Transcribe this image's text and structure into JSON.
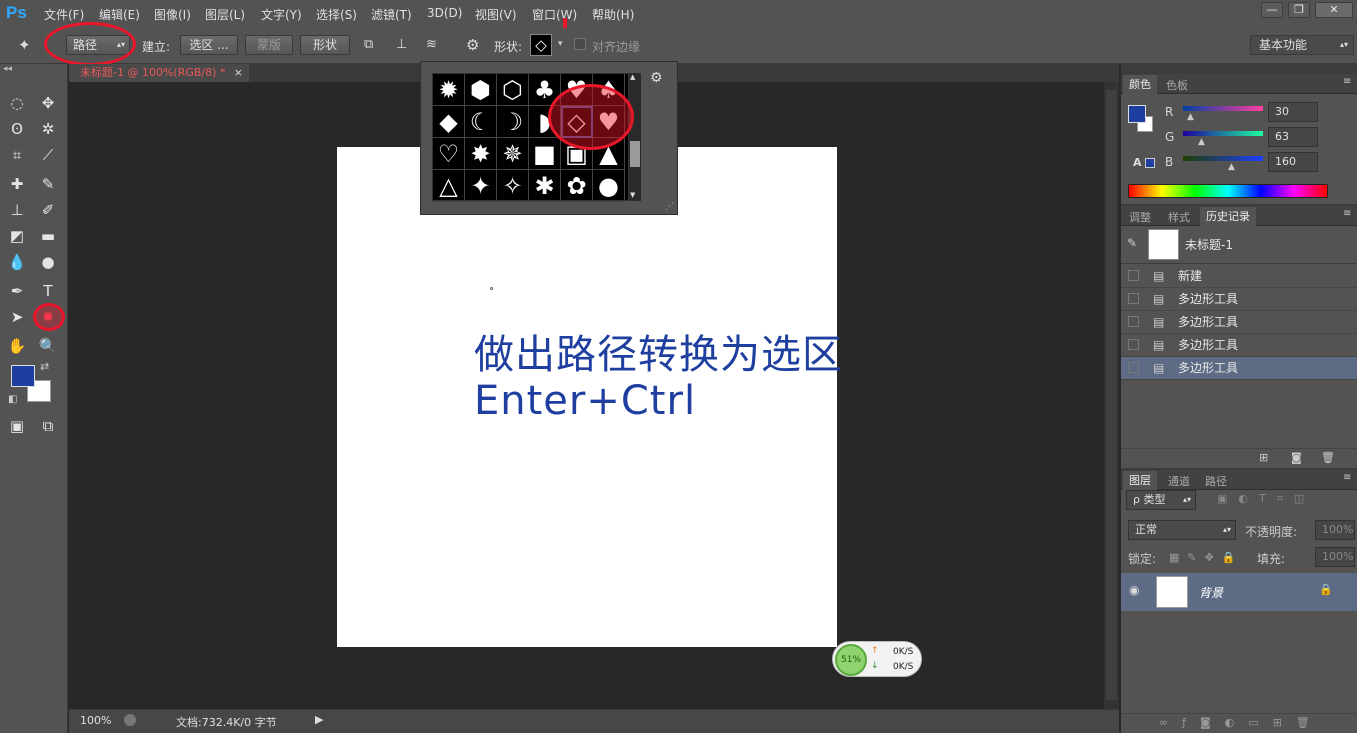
{
  "app": {
    "logo": "Ps"
  },
  "menu": [
    "文件(F)",
    "编辑(E)",
    "图像(I)",
    "图层(L)",
    "文字(Y)",
    "选择(S)",
    "滤镜(T)",
    "3D(D)",
    "视图(V)",
    "窗口(W)",
    "帮助(H)"
  ],
  "window_controls": {
    "minimize": "—",
    "restore": "❐",
    "close": "✕"
  },
  "options": {
    "mode_value": "路径",
    "make_label": "建立:",
    "selection_btn": "选区 ...",
    "mask_btn": "蒙版",
    "shape_btn": "形状",
    "shape_label": "形状:",
    "align_edges": "对齐边缘",
    "workspace": "基本功能"
  },
  "document": {
    "tab_title": "未标题-1 @ 100%(RGB/8) *",
    "tab_close": "×",
    "text_line1": "做出路径转换为选区",
    "text_line2": "Enter+Ctrl"
  },
  "shape_picker": {
    "shapes": [
      "✹",
      "⬢",
      "⬡",
      "♣",
      "♥",
      "♠",
      "◆",
      "☾",
      "☽",
      "◗",
      "◇",
      "♥",
      "♡",
      "✸",
      "✵",
      "■",
      "▣",
      "▲",
      "△",
      "✦",
      "✧",
      "✱",
      "✿",
      "●"
    ]
  },
  "status": {
    "zoom": "100%",
    "doc_info": "文档:732.4K/0 字节"
  },
  "net_widget": {
    "percent": "51%",
    "up": "0K/S",
    "down": "0K/S"
  },
  "color_panel": {
    "tabs": [
      "颜色",
      "色板"
    ],
    "channels": [
      {
        "label": "R",
        "value": "30"
      },
      {
        "label": "G",
        "value": "63"
      },
      {
        "label": "B",
        "value": "160"
      }
    ],
    "foreground": "#1e3fa0"
  },
  "history_panel": {
    "tabs": [
      "调整",
      "样式",
      "历史记录"
    ],
    "snapshot": "未标题-1",
    "items": [
      "新建",
      "多边形工具",
      "多边形工具",
      "多边形工具",
      "多边形工具"
    ]
  },
  "layers_panel": {
    "tabs": [
      "图层",
      "通道",
      "路径"
    ],
    "filter": "ρ 类型",
    "blend_mode": "正常",
    "opacity_label": "不透明度:",
    "opacity_value": "100%",
    "lock_label": "锁定:",
    "fill_label": "填充:",
    "fill_value": "100%",
    "layer_name": "背景"
  }
}
